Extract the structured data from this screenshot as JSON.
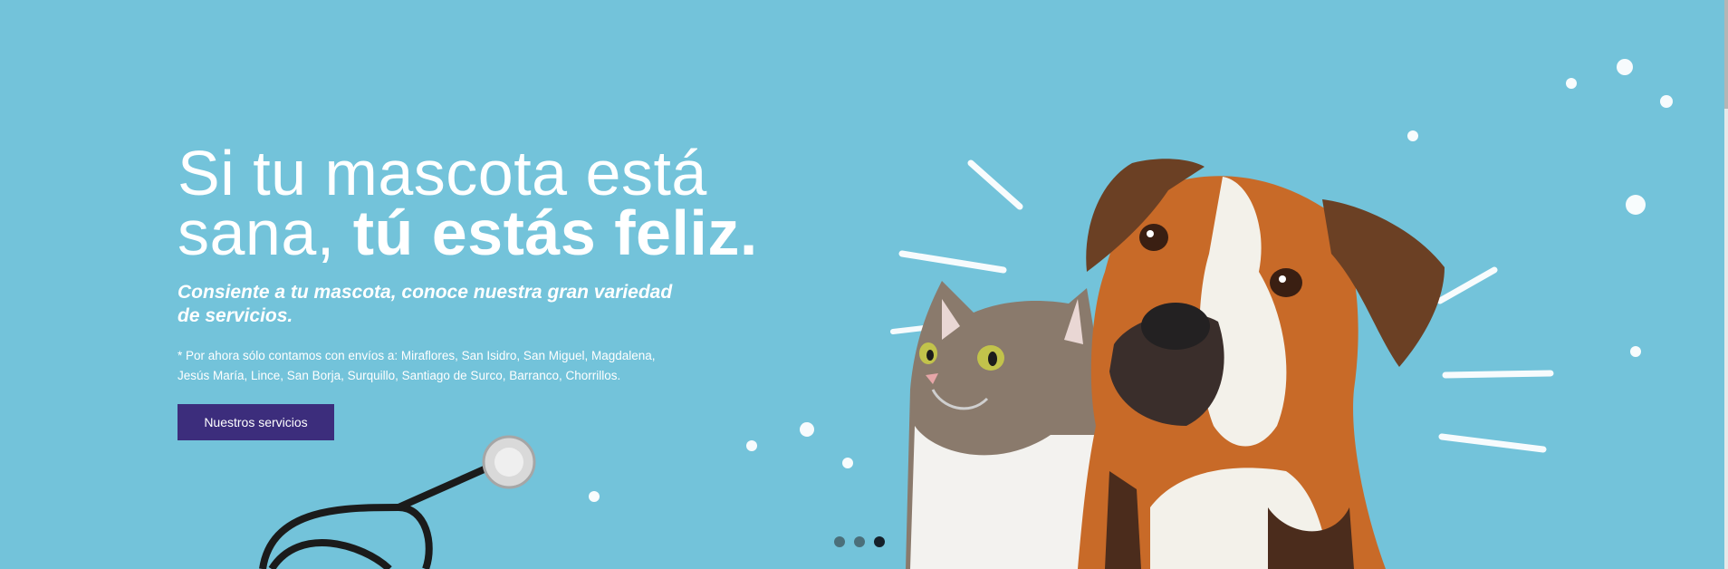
{
  "hero": {
    "headline_part1": "Si tu mascota está",
    "headline_part2": "sana, ",
    "headline_bold": "tú estás feliz.",
    "subheadline": "Consiente a tu mascota, conoce nuestra gran variedad de servicios.",
    "note": "* Por ahora sólo contamos con envíos a: Miraflores, San Isidro, San Miguel, Magdalena, Jesús María, Lince, San Borja, Surquillo, Santiago de Surco, Barranco, Chorrillos.",
    "cta_label": "Nuestros servicios",
    "background_color": "#73c3da",
    "cta_color": "#3c2d7c"
  },
  "carousel": {
    "slide_count": 3,
    "active_slide": 3
  }
}
